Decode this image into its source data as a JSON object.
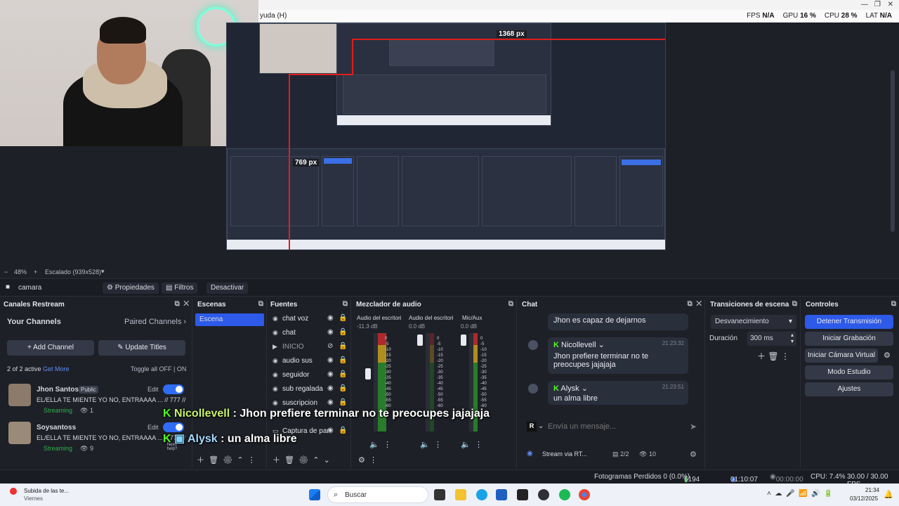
{
  "topbar": {
    "menu_partial": "yuda (H)",
    "fps_label": "FPS",
    "fps_value": "N/A",
    "gpu_label": "GPU",
    "gpu_value": "16 %",
    "cpu_label": "CPU",
    "cpu_value": "28 %",
    "lat_label": "LAT",
    "lat_value": "N/A"
  },
  "preview": {
    "measure_width": "1368 px",
    "measure_height": "769 px",
    "overlay_line1_user": "Nicollevell",
    "overlay_line1_text": ": Jhon prefiere terminar no te preocupes jajajaja",
    "overlay_line2_user": "Alysk",
    "overlay_line2_text": ": un alma libre"
  },
  "zoom": {
    "percent": "48%",
    "scaling": "Escalado (939x528)"
  },
  "scenebar": {
    "scene_name": "camara",
    "properties": "Propiedades",
    "filters": "Filtros",
    "deactivate": "Desactivar"
  },
  "restream": {
    "title": "Canales Restream",
    "your_channels": "Your Channels",
    "paired_channels": "Paired Channels",
    "add_channel": "Add Channel",
    "update_titles": "Update Titles",
    "active_count": "2 of 2 active",
    "get_more": "Get More",
    "toggle_all": "Toggle all",
    "off": "OFF",
    "on": "ON",
    "edit": "Edit",
    "help": "Need help?",
    "channels": [
      {
        "name": "Jhon Santos",
        "badge": "Public",
        "title": "EL/ELLA TE MIENTE YO NO, ENTRAAAA ... // 777 //",
        "status": "Streaming",
        "viewers": "1"
      },
      {
        "name": "Soysantoss",
        "badge": "",
        "title": "EL/ELLA TE MIENTE YO NO, ENTRAAAA ... // 777 //",
        "status": "Streaming",
        "viewers": "9"
      }
    ]
  },
  "scenes": {
    "title": "Escenas",
    "items": [
      "Escena"
    ]
  },
  "sources": {
    "title": "Fuentes",
    "items": [
      "chat voz",
      "chat",
      "INICIO",
      "audio sus",
      "seguidor",
      "sub regalada",
      "suscripcion",
      "",
      "Captura de par"
    ]
  },
  "mixer": {
    "title": "Mezclador de audio",
    "channels": [
      {
        "name": "Audio del escritorio",
        "db": "-11.3 dB"
      },
      {
        "name": "Audio del escritorio",
        "db": "0.0 dB"
      },
      {
        "name": "Mic/Aux",
        "db": "0.0 dB"
      }
    ],
    "scale": [
      "0",
      "-5",
      "-10",
      "-15",
      "-20",
      "-25",
      "-30",
      "-35",
      "-40",
      "-45",
      "-50",
      "-55",
      "-60"
    ]
  },
  "chat": {
    "title": "Chat",
    "messages": [
      {
        "user": "Jhon es capaz de dejarnos",
        "text": "",
        "time": ""
      },
      {
        "user": "Nicollevell",
        "text": "Jhon prefiere terminar no te preocupes jajajaja",
        "time": "21:23:32"
      },
      {
        "user": "Alysk",
        "text": "un alma libre",
        "time": "21:23:51"
      }
    ],
    "input_placeholder": "Envía un mensaje...",
    "reply_initial": "R",
    "stream_via": "Stream via RT...",
    "pages": "2/2",
    "viewers": "10"
  },
  "transitions": {
    "title": "Transiciones de escena",
    "selected": "Desvanecimiento",
    "duration_label": "Duración",
    "duration_value": "300 ms"
  },
  "controls": {
    "title": "Controles",
    "stop_stream": "Detener Transmisión",
    "start_recording": "Iniciar Grabación",
    "start_virtual_cam": "Iniciar Cámara Virtual",
    "studio_mode": "Modo Estudio",
    "settings": "Ajustes"
  },
  "statusbar": {
    "dropped_frames": "Fotogramas Perdidos 0 (0.0%)",
    "bitrate": "6194 kbps",
    "stream_time": "01:10:07",
    "rec_time": "00:00:00",
    "cpu": "CPU: 7.4%",
    "fps": "30.00 / 30.00 FPS"
  },
  "taskbar": {
    "notification_title": "Subida de las te...",
    "notification_sub": "Viernes",
    "search": "Buscar",
    "time": "21:34",
    "date": "03/12/2025"
  }
}
